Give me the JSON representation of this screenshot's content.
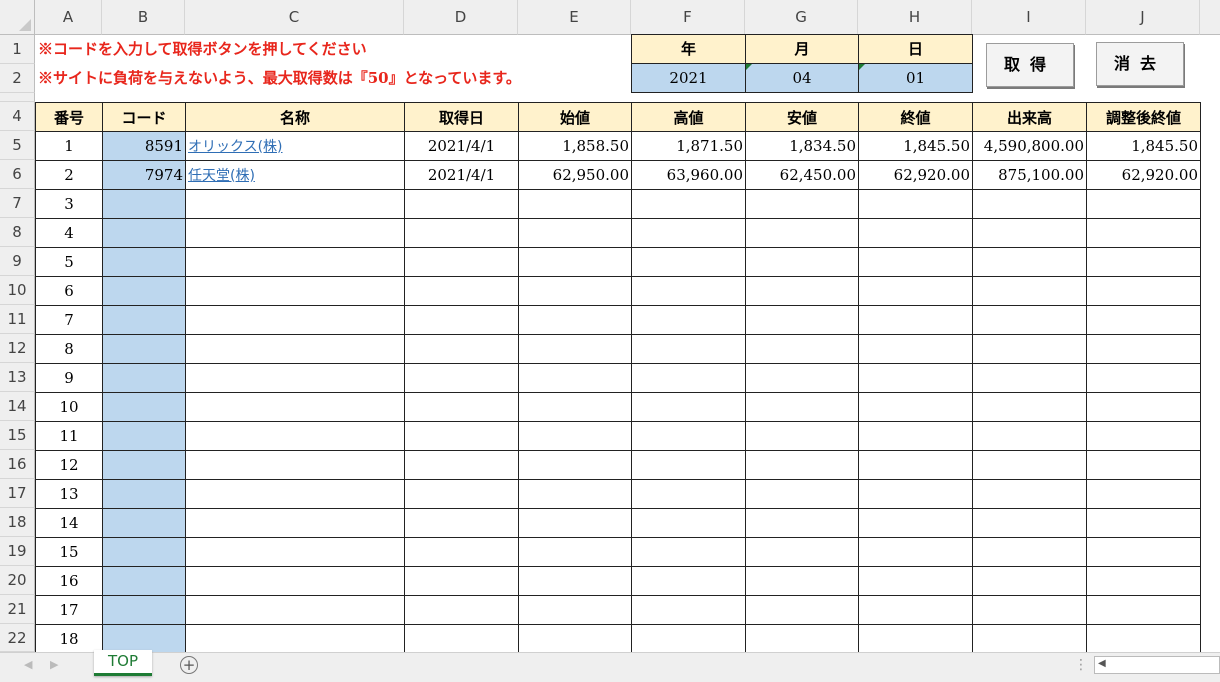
{
  "columns": [
    "A",
    "B",
    "C",
    "D",
    "E",
    "F",
    "G",
    "H",
    "I",
    "J"
  ],
  "row_numbers": [
    "1",
    "2",
    "4",
    "5",
    "6",
    "7",
    "8",
    "9",
    "10",
    "11",
    "12",
    "13",
    "14",
    "15",
    "16",
    "17",
    "18",
    "19",
    "20",
    "21",
    "22"
  ],
  "notes": {
    "line1": "※コードを入力して取得ボタンを押してください",
    "line2": "※サイトに負荷を与えないよう、最大取得数は『50』となっています。"
  },
  "date_box": {
    "year_label": "年",
    "month_label": "月",
    "day_label": "日",
    "year": "2021",
    "month": "04",
    "day": "01"
  },
  "buttons": {
    "get": "取得",
    "clear": "消去"
  },
  "table": {
    "headers": [
      "番号",
      "コード",
      "名称",
      "取得日",
      "始値",
      "高値",
      "安値",
      "終値",
      "出来高",
      "調整後終値"
    ],
    "rows": [
      {
        "no": "1",
        "code": "8591",
        "name": "オリックス(株)",
        "date": "2021/4/1",
        "open": "1,858.50",
        "high": "1,871.50",
        "low": "1,834.50",
        "close": "1,845.50",
        "volume": "4,590,800.00",
        "adj": "1,845.50"
      },
      {
        "no": "2",
        "code": "7974",
        "name": "任天堂(株)",
        "date": "2021/4/1",
        "open": "62,950.00",
        "high": "63,960.00",
        "low": "62,450.00",
        "close": "62,920.00",
        "volume": "875,100.00",
        "adj": "62,920.00"
      },
      {
        "no": "3"
      },
      {
        "no": "4"
      },
      {
        "no": "5"
      },
      {
        "no": "6"
      },
      {
        "no": "7"
      },
      {
        "no": "8"
      },
      {
        "no": "9"
      },
      {
        "no": "10"
      },
      {
        "no": "11"
      },
      {
        "no": "12"
      },
      {
        "no": "13"
      },
      {
        "no": "14"
      },
      {
        "no": "15"
      },
      {
        "no": "16"
      },
      {
        "no": "17"
      },
      {
        "no": "18"
      }
    ]
  },
  "sheet_tab": "TOP",
  "icons": {
    "add_sheet": "plus-circle-icon",
    "nav_prev": "arrow-left-icon",
    "nav_next": "arrow-right-icon"
  },
  "colors": {
    "header_fill": "#fff2cc",
    "code_fill": "#bdd7ee",
    "note_red": "#e8261c",
    "link_blue": "#2f6eb5",
    "tab_green": "#1e7b34"
  }
}
